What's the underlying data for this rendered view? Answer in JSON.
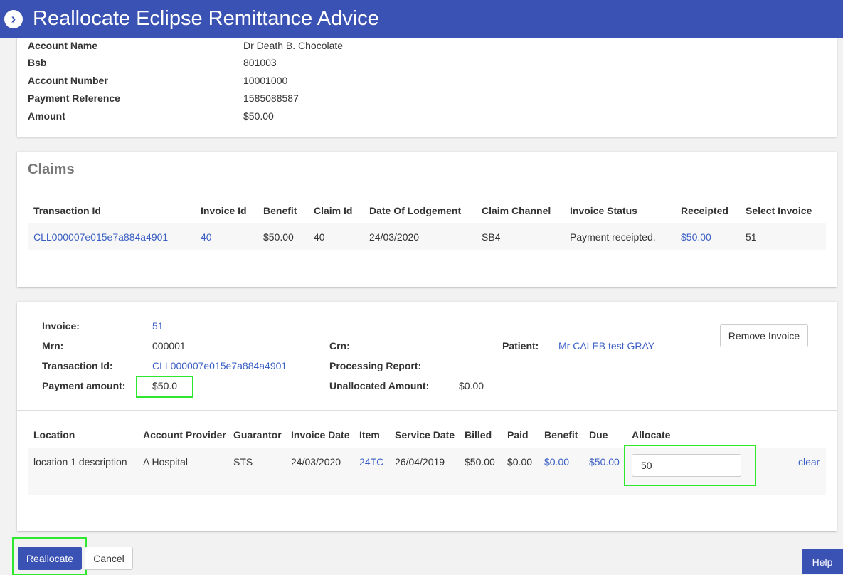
{
  "header": {
    "title": "Reallocate Eclipse Remittance Advice"
  },
  "account": {
    "rows": [
      {
        "label": "Account Name",
        "value": "Dr Death B. Chocolate"
      },
      {
        "label": "Bsb",
        "value": "801003"
      },
      {
        "label": "Account Number",
        "value": "10001000"
      },
      {
        "label": "Payment Reference",
        "value": "1585088587"
      },
      {
        "label": "Amount",
        "value": "$50.00"
      }
    ]
  },
  "claims": {
    "title": "Claims",
    "headers": [
      "Transaction Id",
      "Invoice Id",
      "Benefit",
      "Claim Id",
      "Date Of Lodgement",
      "Claim Channel",
      "Invoice Status",
      "Receipted",
      "Select Invoice"
    ],
    "row": [
      "CLL000007e015e7a884a4901",
      "40",
      "$50.00",
      "40",
      "24/03/2020",
      "SB4",
      "Payment receipted.",
      "$50.00",
      "51"
    ]
  },
  "invoice": {
    "invoice_label": "Invoice:",
    "invoice_value": "51",
    "mrn_label": "Mrn:",
    "mrn_value": "000001",
    "txn_label": "Transaction Id:",
    "txn_value": "CLL000007e015e7a884a4901",
    "payment_label": "Payment amount:",
    "payment_value": "$50.0",
    "crn_label": "Crn:",
    "processing_label": "Processing Report:",
    "unallocated_label": "Unallocated Amount:",
    "unallocated_value": "$0.00",
    "patient_label": "Patient:",
    "patient_value": "Mr CALEB test GRAY",
    "remove_button": "Remove Invoice",
    "headers": [
      "Location",
      "Account Provider",
      "Guarantor",
      "Invoice Date",
      "Item",
      "Service Date",
      "Billed",
      "Paid",
      "Benefit",
      "Due",
      "Allocate"
    ],
    "row": [
      "location 1 description",
      "A Hospital",
      "STS",
      "24/03/2020",
      "24TC",
      "26/04/2019",
      "$50.00",
      "$0.00",
      "$0.00",
      "$50.00"
    ],
    "allocate_value": "50",
    "clear_link": "clear"
  },
  "actions": {
    "reallocate": "Reallocate",
    "cancel": "Cancel",
    "help": "Help"
  },
  "colors": {
    "header": "#3a52b4",
    "link": "#3a5fc4",
    "highlight": "#2ee82e"
  }
}
